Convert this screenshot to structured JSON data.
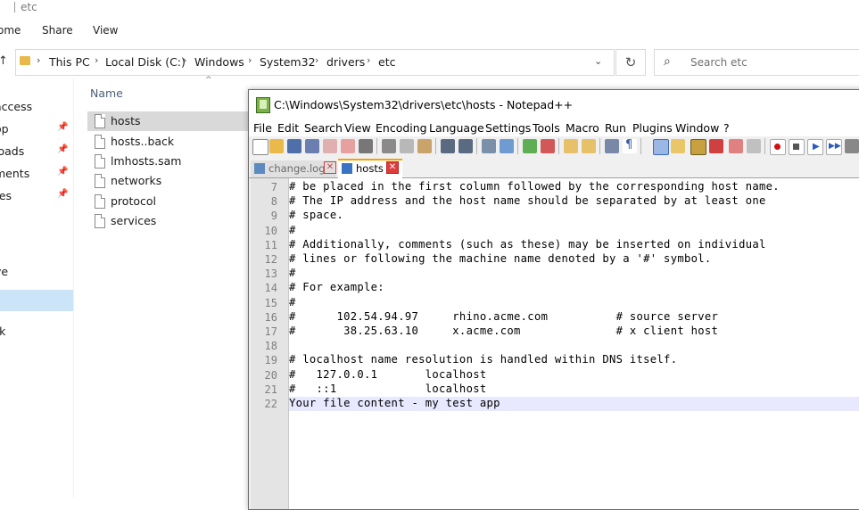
{
  "explorer": {
    "title": "etc",
    "ribbon_tabs": [
      "ome",
      "Share",
      "View"
    ],
    "breadcrumb": [
      "This PC",
      "Local Disk (C:)",
      "Windows",
      "System32",
      "drivers",
      "etc"
    ],
    "search_placeholder": "Search etc",
    "nav_items": [
      {
        "label": "access",
        "pinned": false
      },
      {
        "label": "op",
        "pinned": true
      },
      {
        "label": "loads",
        "pinned": true
      },
      {
        "label": "ments",
        "pinned": true
      },
      {
        "label": "res",
        "pinned": true
      },
      {
        "label": "",
        "pinned": false
      },
      {
        "label": "s",
        "pinned": false
      },
      {
        "label": "ve",
        "pinned": false
      },
      {
        "label": "",
        "pinned": false
      },
      {
        "label": "rk",
        "pinned": false
      }
    ],
    "column_name": "Name",
    "files": [
      "hosts",
      "hosts..back",
      "lmhosts.sam",
      "networks",
      "protocol",
      "services"
    ],
    "selected_file": "hosts"
  },
  "notepad": {
    "title": "C:\\Windows\\System32\\drivers\\etc\\hosts - Notepad++",
    "menu": [
      "File",
      "Edit",
      "Search",
      "View",
      "Encoding",
      "Language",
      "Settings",
      "Tools",
      "Macro",
      "Run",
      "Plugins",
      "Window",
      "?"
    ],
    "tabs": [
      {
        "label": "change.log",
        "active": false
      },
      {
        "label": "hosts",
        "active": true
      }
    ],
    "lines": [
      {
        "num": "7",
        "text": "# be placed in the first column followed by the corresponding host name."
      },
      {
        "num": "8",
        "text": "# The IP address and the host name should be separated by at least one"
      },
      {
        "num": "9",
        "text": "# space."
      },
      {
        "num": "10",
        "text": "#"
      },
      {
        "num": "11",
        "text": "# Additionally, comments (such as these) may be inserted on individual"
      },
      {
        "num": "12",
        "text": "# lines or following the machine name denoted by a '#' symbol."
      },
      {
        "num": "13",
        "text": "#"
      },
      {
        "num": "14",
        "text": "# For example:"
      },
      {
        "num": "15",
        "text": "#"
      },
      {
        "num": "16",
        "text": "#      102.54.94.97     rhino.acme.com          # source server"
      },
      {
        "num": "17",
        "text": "#       38.25.63.10     x.acme.com              # x client host"
      },
      {
        "num": "18",
        "text": ""
      },
      {
        "num": "19",
        "text": "# localhost name resolution is handled within DNS itself."
      },
      {
        "num": "20",
        "text": "#   127.0.0.1       localhost"
      },
      {
        "num": "21",
        "text": "#   ::1             localhost"
      },
      {
        "num": "22",
        "text": "Your file content - my test app"
      }
    ],
    "current_line": "22"
  },
  "colors": {
    "accent_tab": "#f7a000",
    "selection": "#cce4f7",
    "current_line_bg": "#e8e8ff"
  }
}
